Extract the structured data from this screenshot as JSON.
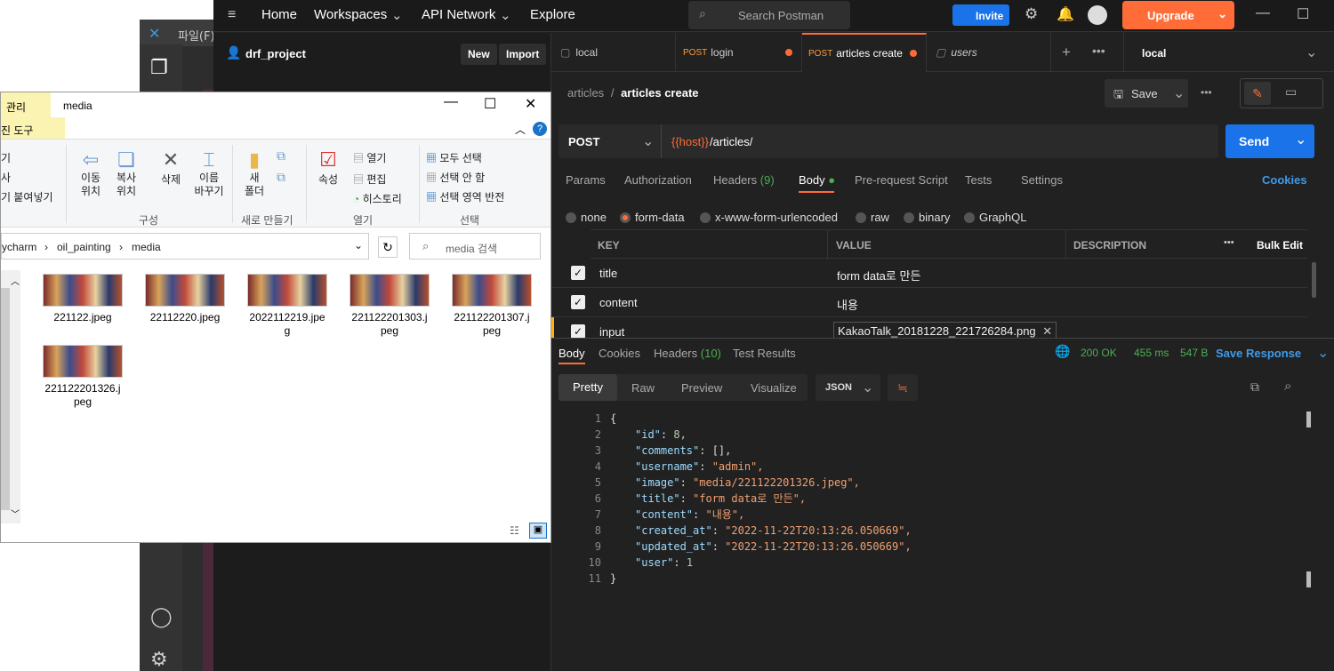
{
  "vscode": {
    "menu_file": "파일(F)"
  },
  "postman": {
    "nav": {
      "home": "Home",
      "workspaces": "Workspaces",
      "api_network": "API Network",
      "explore": "Explore",
      "search": "Search Postman",
      "invite": "Invite",
      "upgrade": "Upgrade"
    },
    "sidebar": {
      "workspace": "drf_project",
      "new": "New",
      "import": "Import"
    },
    "tabs": [
      {
        "method": "",
        "label": "local"
      },
      {
        "method": "POST",
        "label": "login"
      },
      {
        "method": "POST",
        "label": "articles create"
      },
      {
        "method": "",
        "label": "users"
      }
    ],
    "environment": "local",
    "breadcrumb": {
      "parent": "articles",
      "sep": "/",
      "current": "articles create"
    },
    "save": "Save",
    "request": {
      "method": "POST",
      "url_var": "{{host}}",
      "url_path": "/articles/",
      "send": "Send"
    },
    "req_tabs": {
      "params": "Params",
      "authorization": "Authorization",
      "headers": "Headers",
      "headers_count": "(9)",
      "body": "Body",
      "prerequest": "Pre-request Script",
      "tests": "Tests",
      "settings": "Settings",
      "cookies": "Cookies"
    },
    "body_types": [
      "none",
      "form-data",
      "x-www-form-urlencoded",
      "raw",
      "binary",
      "GraphQL"
    ],
    "table": {
      "key": "KEY",
      "value": "VALUE",
      "description": "DESCRIPTION",
      "bulk_edit": "Bulk Edit",
      "rows": [
        {
          "key": "title",
          "value": "form data로 만든"
        },
        {
          "key": "content",
          "value": "내용"
        },
        {
          "key": "input",
          "value": "KakaoTalk_20181228_221726284.png"
        }
      ]
    },
    "response": {
      "tabs": {
        "body": "Body",
        "cookies": "Cookies",
        "headers": "Headers",
        "headers_count": "(10)",
        "test_results": "Test Results"
      },
      "status": "200 OK",
      "time": "455 ms",
      "size": "547 B",
      "save_response": "Save Response",
      "views": [
        "Pretty",
        "Raw",
        "Preview",
        "Visualize"
      ],
      "format": "JSON",
      "lines": [
        {
          "n": "1",
          "t": "{"
        },
        {
          "n": "2",
          "k": "\"id\"",
          "v": "8,"
        },
        {
          "n": "3",
          "k": "\"comments\"",
          "v": "[],"
        },
        {
          "n": "4",
          "k": "\"username\"",
          "v": "\"admin\","
        },
        {
          "n": "5",
          "k": "\"image\"",
          "v": "\"media/221122201326.jpeg\","
        },
        {
          "n": "6",
          "k": "\"title\"",
          "v": "\"form data로 만든\","
        },
        {
          "n": "7",
          "k": "\"content\"",
          "v": "\"내용\","
        },
        {
          "n": "8",
          "k": "\"created_at\"",
          "v": "\"2022-11-22T20:13:26.050669\","
        },
        {
          "n": "9",
          "k": "\"updated_at\"",
          "v": "\"2022-11-22T20:13:26.050669\","
        },
        {
          "n": "10",
          "k": "\"user\"",
          "v": "1"
        },
        {
          "n": "11",
          "t": "}"
        }
      ]
    }
  },
  "explorer": {
    "title": "media",
    "tab_manage": "관리",
    "tab_tools": "진 도구",
    "ribbon": {
      "move": "이동\n위치",
      "copy": "복사\n위치",
      "delete": "삭제",
      "rename": "이름\n바꾸기",
      "newfolder": "새\n폴더",
      "properties": "속성",
      "open": "열기",
      "edit": "편집",
      "history": "히스토리",
      "selectall": "모두 선택",
      "selectnone": "선택 안 함",
      "invert": "선택 영역 반전",
      "grp_org": "구성",
      "grp_new": "새로 만들기",
      "grp_open": "열기",
      "grp_select": "선택",
      "left1": "기",
      "left2": "사",
      "left3": "기 붙여넣기"
    },
    "path": [
      "ycharm",
      "oil_painting",
      "media"
    ],
    "search_placeholder": "media 검색",
    "files": [
      "221122.jpeg",
      "22112220.jpeg",
      "2022112219.jpe\ng",
      "221122201303.j\npeg",
      "221122201307.j\npeg",
      "221122201326.j\npeg"
    ]
  }
}
